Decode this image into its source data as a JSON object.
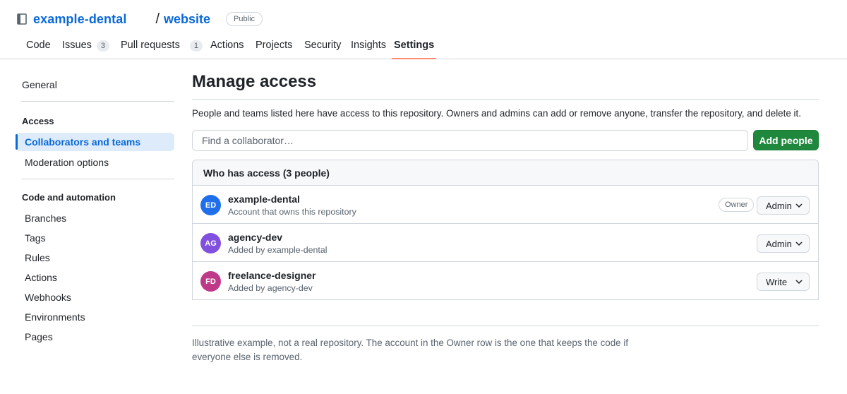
{
  "repo": {
    "owner": "example-dental",
    "separator": "/",
    "name": "website",
    "visibility": "Public",
    "icon": "repo-icon"
  },
  "tabs": [
    {
      "label": "Code"
    },
    {
      "label": "Issues",
      "count": "3"
    },
    {
      "label": "Pull requests",
      "count": "1"
    },
    {
      "label": "Actions"
    },
    {
      "label": "Projects"
    },
    {
      "label": "Security"
    },
    {
      "label": "Insights"
    },
    {
      "label": "Settings",
      "selected": true
    }
  ],
  "sidebar": {
    "general": "General",
    "access_heading": "Access",
    "access_items": [
      "Collaborators and teams",
      "Moderation options"
    ],
    "code_heading": "Code and automation",
    "code_items": [
      "Branches",
      "Tags",
      "Rules",
      "Actions",
      "Webhooks",
      "Environments",
      "Pages"
    ]
  },
  "main": {
    "title": "Manage access",
    "description": "People and teams listed here have access to this repository. Owners and admins can add or remove anyone, transfer the repository, and delete it.",
    "search_placeholder": "Find a collaborator…",
    "add_button": "Add people",
    "list_heading": "Who has access (3 people)",
    "members": [
      {
        "initials": "ED",
        "name": "example-dental",
        "subtitle": "Account that owns this repository",
        "badge": "Owner",
        "role": "Admin",
        "color": "#1f6feb"
      },
      {
        "initials": "AG",
        "name": "agency-dev",
        "subtitle": "Added by example-dental",
        "role": "Admin",
        "color": "#8250df"
      },
      {
        "initials": "FD",
        "name": "freelance-designer",
        "subtitle": "Added by agency-dev",
        "role": "Write",
        "color": "#bf3989"
      }
    ],
    "footer_note": "Illustrative example, not a real repository. The account in the Owner row is the one that keeps the code if everyone else is removed."
  },
  "colors": {
    "link": "#0969da",
    "primary_button": "#1f883d",
    "tab_underline": "#fd8c73",
    "selected_sidebar_bg": "#ddebfa"
  }
}
